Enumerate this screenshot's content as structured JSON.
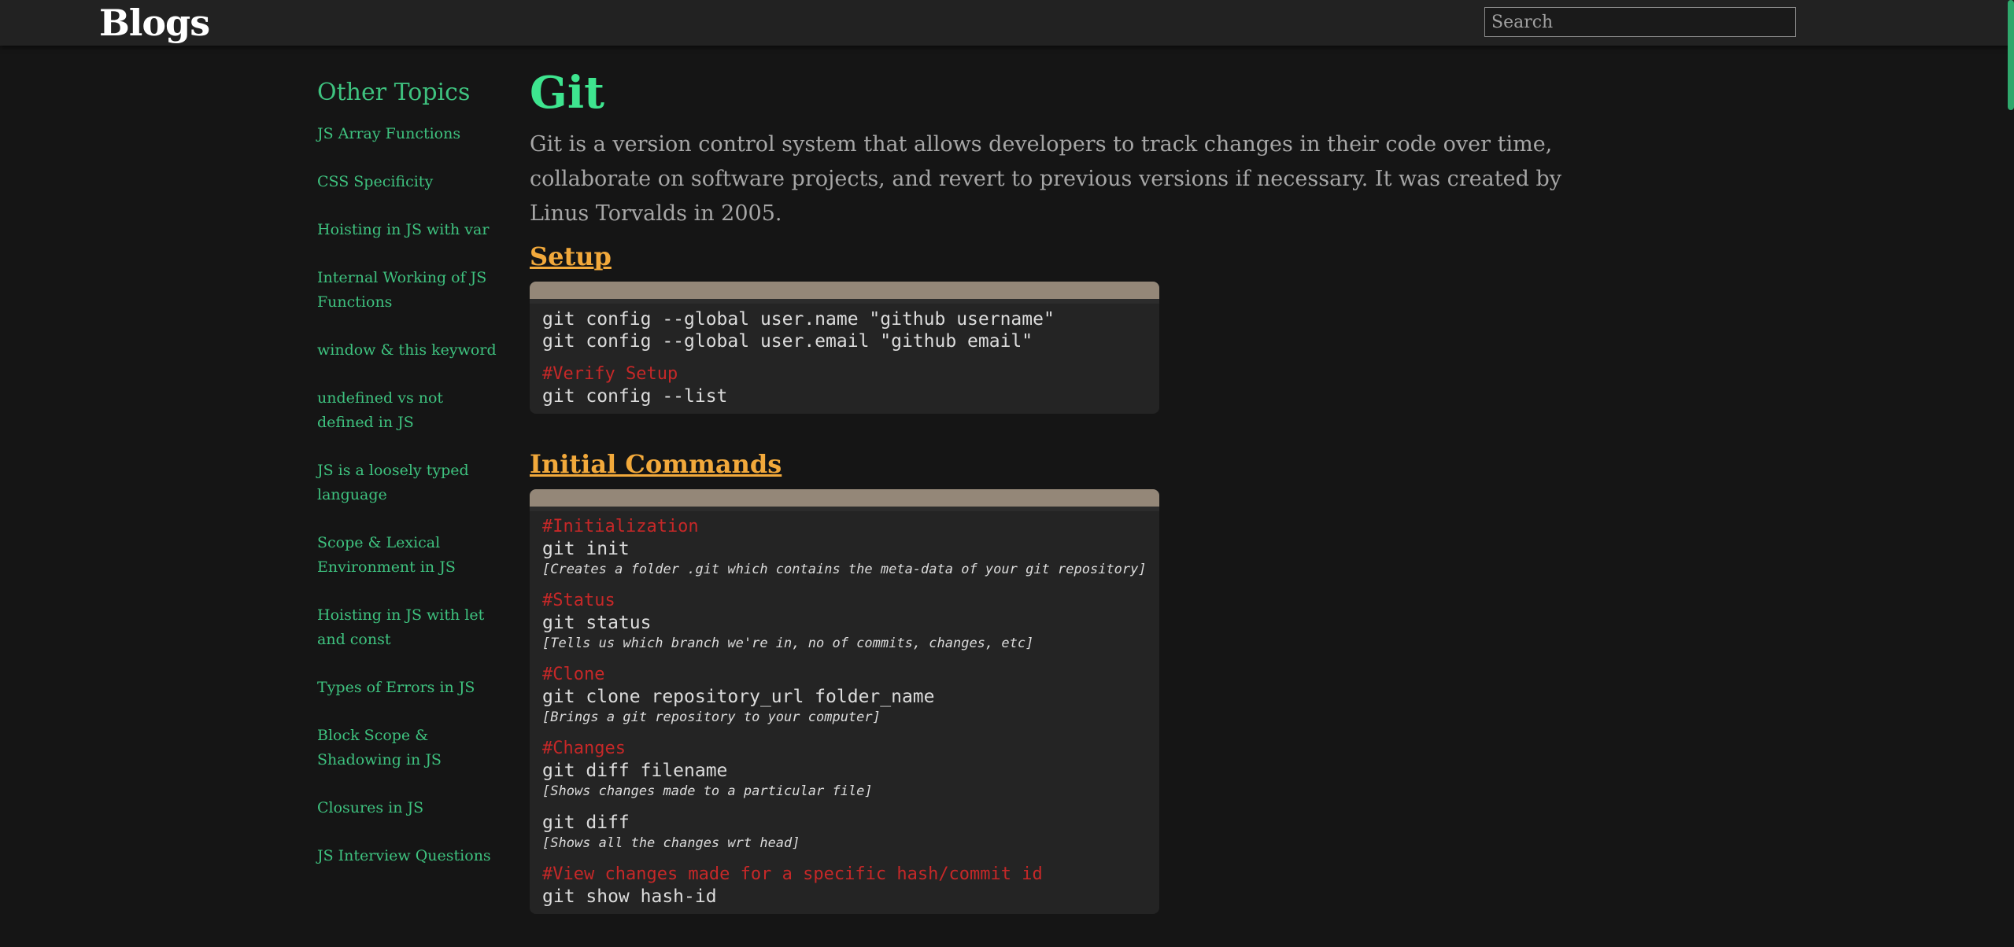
{
  "header": {
    "brand": "Blogs",
    "search_placeholder": "Search"
  },
  "sidebar": {
    "heading": "Other Topics",
    "items": [
      "JS Array Functions",
      "CSS Specificity",
      "Hoisting in JS with var",
      "Internal Working of JS Functions",
      "window & this keyword",
      "undefined vs not defined in JS",
      "JS is a loosely typed language",
      "Scope & Lexical Environment in JS",
      "Hoisting in JS with let and const",
      "Types of Errors in JS",
      "Block Scope & Shadowing in JS",
      "Closures in JS",
      "JS Interview Questions"
    ]
  },
  "article": {
    "title": "Git",
    "intro": "Git is a version control system that allows developers to track changes in their code over time, collaborate on software projects, and revert to previous versions if necessary. It was created by Linus Torvalds in 2005.",
    "sections": [
      {
        "title": "Setup",
        "blocks": [
          {
            "comment": "",
            "commands": [
              "git config --global user.name \"github username\"",
              "git config --global user.email \"github email\""
            ],
            "note": ""
          },
          {
            "comment": "#Verify Setup",
            "commands": [
              "git config --list"
            ],
            "note": ""
          }
        ]
      },
      {
        "title": "Initial Commands",
        "blocks": [
          {
            "comment": "#Initialization",
            "commands": [
              "git init"
            ],
            "note": "[Creates a folder .git which contains the meta-data of your git repository]"
          },
          {
            "comment": "#Status",
            "commands": [
              "git status"
            ],
            "note": "[Tells us which branch we're in, no of commits, changes, etc]"
          },
          {
            "comment": "#Clone",
            "commands": [
              "git clone repository_url folder_name"
            ],
            "note": "[Brings a git repository to your computer]"
          },
          {
            "comment": "#Changes",
            "commands": [
              "git diff filename"
            ],
            "note": "[Shows changes made to a particular file]"
          },
          {
            "comment": "",
            "commands": [
              "git diff"
            ],
            "note": "[Shows all the changes wrt head]"
          },
          {
            "comment": "#View changes made for a specific hash/commit id",
            "commands": [
              "git show hash-id"
            ],
            "note": ""
          }
        ]
      }
    ]
  },
  "colors": {
    "accent_green": "#3ec27f",
    "title_green": "#3ee58f",
    "section_orange": "#f2a93b",
    "comment_red": "#c62828",
    "code_header": "#948778"
  }
}
